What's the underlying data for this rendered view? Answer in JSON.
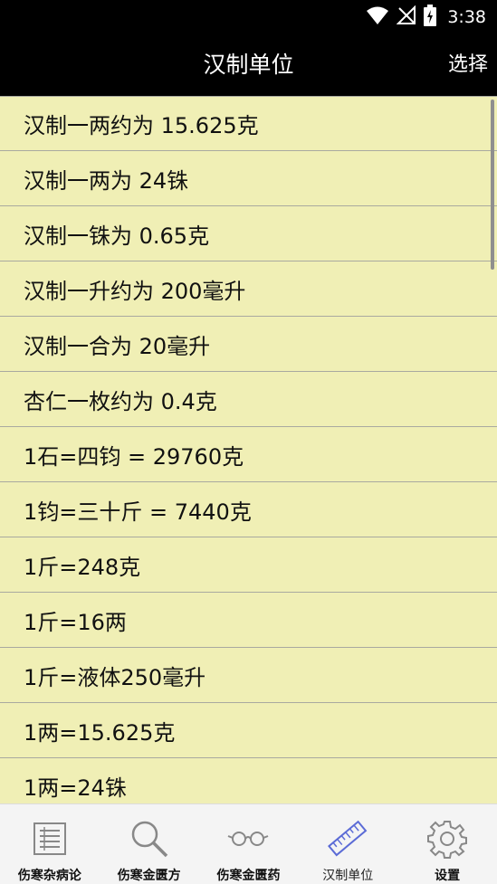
{
  "status": {
    "time": "3:38"
  },
  "header": {
    "title": "汉制单位",
    "action_label": "选择"
  },
  "list_items": [
    "汉制一两约为 15.625克",
    "汉制一两为 24铢",
    "汉制一铢为 0.65克",
    "汉制一升约为 200毫升",
    "汉制一合为 20毫升",
    "杏仁一枚约为 0.4克",
    "1石=四钧 = 29760克",
    "1钧=三十斤 = 7440克",
    "1斤=248克",
    "1斤=16两",
    "1斤=液体250毫升",
    "1两=15.625克",
    "1两=24铢"
  ],
  "nav": [
    {
      "label": "伤寒杂病论",
      "icon": "list-icon"
    },
    {
      "label": "伤寒金匮方",
      "icon": "search-icon"
    },
    {
      "label": "伤寒金匮药",
      "icon": "glasses-icon"
    },
    {
      "label": "汉制单位",
      "icon": "ruler-icon",
      "active": true
    },
    {
      "label": "设置",
      "icon": "gear-icon"
    }
  ],
  "colors": {
    "list_bg": "#f0efb5",
    "bar_bg": "#000000",
    "nav_bg": "#f4f4f4",
    "active_icon": "#5b6bd6",
    "inactive_icon": "#888888"
  }
}
